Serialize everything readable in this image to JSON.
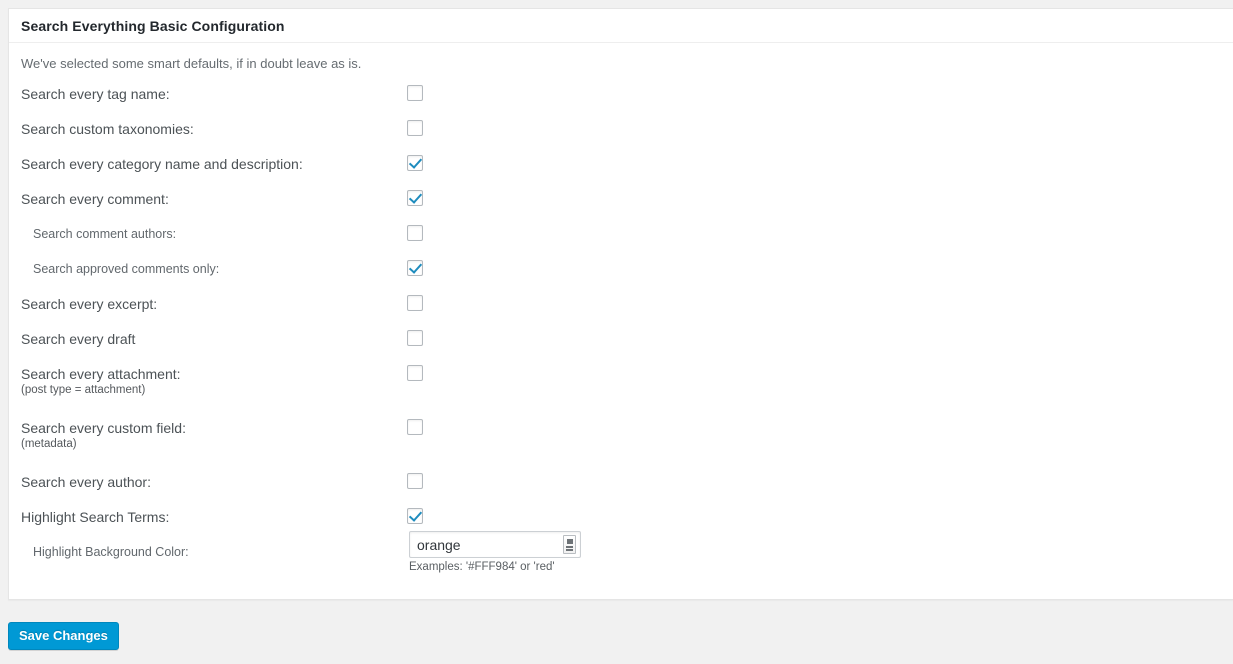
{
  "card": {
    "title": "Search Everything Basic Configuration",
    "intro": "We've selected some smart defaults, if in doubt leave as is."
  },
  "options": [
    {
      "label": "Search every tag name:",
      "checked": false,
      "sub": false,
      "note": null
    },
    {
      "label": "Search custom taxonomies:",
      "checked": false,
      "sub": false,
      "note": null
    },
    {
      "label": "Search every category name and description:",
      "checked": true,
      "sub": false,
      "note": null
    },
    {
      "label": "Search every comment:",
      "checked": true,
      "sub": false,
      "note": null
    },
    {
      "label": "Search comment authors:",
      "checked": false,
      "sub": true,
      "note": null
    },
    {
      "label": "Search approved comments only:",
      "checked": true,
      "sub": true,
      "note": null
    },
    {
      "label": "Search every excerpt:",
      "checked": false,
      "sub": false,
      "note": null
    },
    {
      "label": "Search every draft",
      "checked": false,
      "sub": false,
      "note": null
    },
    {
      "label": "Search every attachment:",
      "checked": false,
      "sub": false,
      "note": "(post type = attachment)"
    },
    {
      "label": "Search every custom field:",
      "checked": false,
      "sub": false,
      "note": "(metadata)"
    },
    {
      "label": "Search every author:",
      "checked": false,
      "sub": false,
      "note": null
    },
    {
      "label": "Highlight Search Terms:",
      "checked": true,
      "sub": false,
      "note": null
    }
  ],
  "highlight_color": {
    "label": "Highlight Background Color:",
    "value": "orange",
    "placeholder": "",
    "examples": "Examples: '#FFF984' or 'red'",
    "picker_icon": "color-picker-icon"
  },
  "submit": {
    "save_label": "Save Changes"
  },
  "colors": {
    "accent": "#0099d5",
    "checkmark": "#1e8cbe",
    "page_background": "#f1f1f1",
    "card_background": "#ffffff",
    "card_border": "#e5e5e5",
    "title_text": "#23282d",
    "label_text": "#4c5256"
  }
}
